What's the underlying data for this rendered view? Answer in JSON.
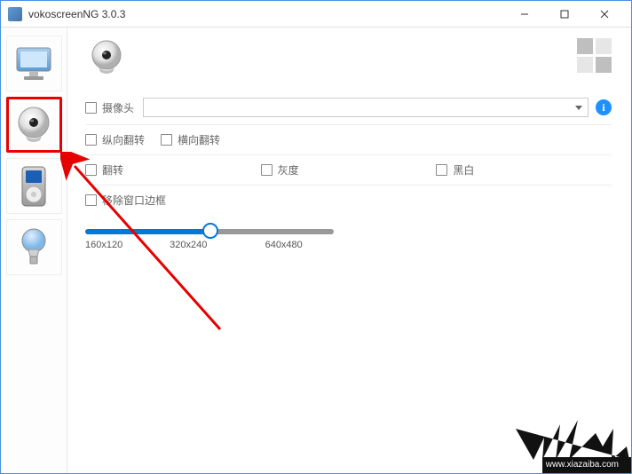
{
  "titlebar": {
    "title": "vokoscreenNG 3.0.3"
  },
  "main": {
    "camera_label": "摄像头",
    "flip_v_label": "纵向翻转",
    "flip_h_label": "横向翻转",
    "flip_label": "翻转",
    "gray_label": "灰度",
    "bw_label": "黑白",
    "remove_border_label": "移除窗口边框"
  },
  "slider": {
    "t1": "160x120",
    "t2": "320x240",
    "t3": "640x480"
  },
  "info": {
    "icon_text": "i"
  },
  "watermark": {
    "url": "www.xiazaiba.com"
  }
}
